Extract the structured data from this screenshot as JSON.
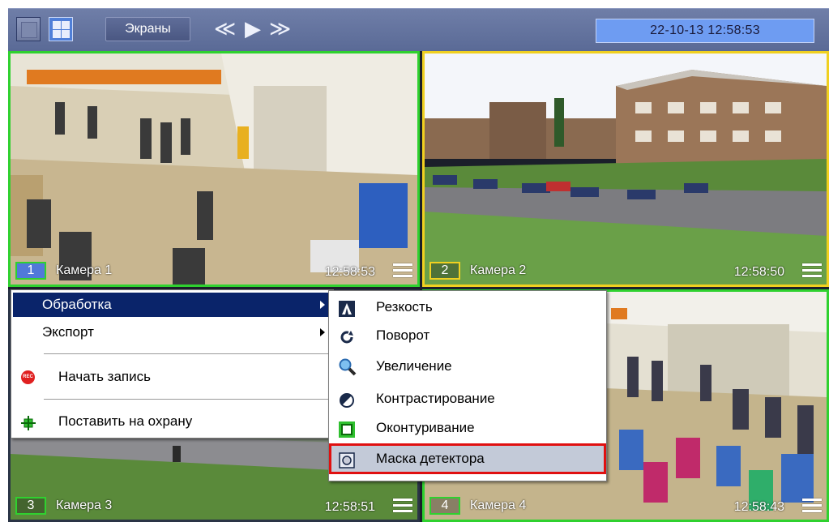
{
  "toolbar": {
    "screens_label": "Экраны",
    "nav_prev": "≪",
    "nav_play": "▶",
    "nav_next": "≫",
    "datetime": "22-10-13  12:58:53"
  },
  "cameras": [
    {
      "num": "1",
      "name": "Камера 1",
      "time": "12:58:53"
    },
    {
      "num": "2",
      "name": "Камера 2",
      "time": "12:58:50"
    },
    {
      "num": "3",
      "name": "Камера 3",
      "time": "12:58:51"
    },
    {
      "num": "4",
      "name": "Камера 4",
      "time": "12:58:43"
    }
  ],
  "context_menu": {
    "items": [
      {
        "label": "Обработка",
        "has_submenu": true,
        "selected": true
      },
      {
        "label": "Экспорт",
        "has_submenu": true
      },
      {
        "label": "Начать запись",
        "icon": "rec-icon"
      },
      {
        "label": "Поставить на охрану",
        "icon": "arm-icon"
      }
    ],
    "rec_badge": "REC"
  },
  "submenu": {
    "items": [
      {
        "label": "Резкость",
        "icon": "sharpness-icon"
      },
      {
        "label": "Поворот",
        "icon": "rotate-icon"
      },
      {
        "label": "Увеличение",
        "icon": "zoom-icon"
      },
      {
        "label": "Контрастирование",
        "icon": "contrast-icon"
      },
      {
        "label": "Оконтуривание",
        "icon": "contour-icon"
      },
      {
        "label": "Маска детектора",
        "icon": "detector-mask-icon",
        "highlighted": true
      }
    ]
  },
  "colors": {
    "toolbar": "#5f6e9c",
    "active_frame": "#2fd12f",
    "selected_frame": "#f0d020",
    "menu_selected": "#0a246a",
    "highlight_outline": "#e01010"
  }
}
